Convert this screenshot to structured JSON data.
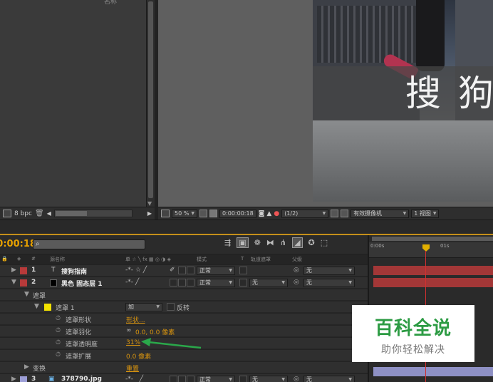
{
  "project_panel": {
    "top_label": "名称",
    "bpc_label": "8 bpc"
  },
  "composition": {
    "zoom": "50 %",
    "timecode": "0:00:00:18",
    "resolution": "(1/2)",
    "camera": "有效摄像机",
    "view": "1 视图",
    "overlay_text": "搜 狗"
  },
  "timeline": {
    "current_time": "0:00:00:18",
    "search_placeholder": "",
    "columns": {
      "index": "#",
      "source_name": "源名称",
      "switches": "单 ☆ ╲ fx ▦ ◎ ◑ ◈",
      "mode": "模式",
      "track_matte_t": "T",
      "track_matte": "轨道遮罩",
      "parent": "父级"
    },
    "ruler": {
      "start": "0:00s",
      "mark_1s": "01s"
    },
    "layers": [
      {
        "index": "1",
        "type_icon": "T",
        "name": "搜狗指南",
        "color": "#b83a3a",
        "mode": "正常",
        "track_matte": "",
        "parent": "无"
      },
      {
        "index": "2",
        "name": "黑色 固态层 1",
        "color": "#b83a3a",
        "mode": "正常",
        "track_matte": "无",
        "parent": "无"
      },
      {
        "index": "3",
        "name": "378790.jpg",
        "color": "#9c9ed6",
        "mode": "正常",
        "track_matte": "无",
        "parent": "无"
      }
    ],
    "mask_group_label": "遮罩",
    "mask": {
      "name": "遮罩 1",
      "mode": "加",
      "invert_label": "反转",
      "props": [
        {
          "label": "遮罩形状",
          "value": "形状..."
        },
        {
          "label": "遮罩羽化",
          "value": "0.0, 0.0 像素"
        },
        {
          "label": "遮罩透明度",
          "value": "31%"
        },
        {
          "label": "遮罩扩展",
          "value": "0.0 像素"
        }
      ]
    },
    "transform_label": "变换",
    "transform_reset": "重置"
  },
  "watermark": {
    "title": "百科全说",
    "subtitle": "助你轻松解决"
  },
  "colors": {
    "accent": "#d7930f",
    "timecode": "#e6a000",
    "playhead": "#d03030",
    "annotation_arrow": "#2aa84a",
    "watermark_green": "#2c9b43"
  }
}
